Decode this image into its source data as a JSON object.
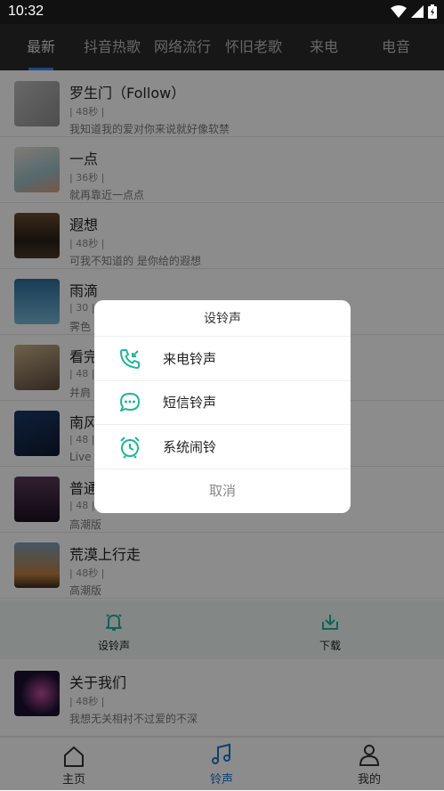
{
  "status": {
    "time": "10:32"
  },
  "tabs": [
    "最新",
    "抖音热歌",
    "网络流行",
    "怀旧老歌",
    "来电",
    "电音"
  ],
  "songs": [
    {
      "title": "罗生门（Follow）",
      "duration": "48秒",
      "desc": "我知道我的爱对你来说就好像软禁"
    },
    {
      "title": "一点",
      "duration": "36秒",
      "desc": "就再靠近一点点"
    },
    {
      "title": "遐想",
      "duration": "48秒",
      "desc": "可我不知道的 是你给的遐想"
    },
    {
      "title": "雨滴",
      "duration": "30",
      "desc": "霁色"
    },
    {
      "title": "看完",
      "duration": "48",
      "desc": "并肩"
    },
    {
      "title": "南风",
      "duration": "48",
      "desc": "Live"
    },
    {
      "title": "普通",
      "duration": "48",
      "desc": "高潮版"
    },
    {
      "title": "荒漠上行走",
      "duration": "48秒",
      "desc": "高潮版"
    },
    {
      "title": "关于我们",
      "duration": "48秒",
      "desc": "我想无关相衬不过爱的不深"
    }
  ],
  "actions": {
    "set_ringtone": "设铃声",
    "download": "下载"
  },
  "nav": {
    "home": "主页",
    "ringtone": "铃声",
    "mine": "我的"
  },
  "dialog": {
    "title": "设铃声",
    "options": [
      {
        "label": "来电铃声",
        "icon": "phone-incoming-icon"
      },
      {
        "label": "短信铃声",
        "icon": "message-icon"
      },
      {
        "label": "系统闹铃",
        "icon": "alarm-clock-icon"
      }
    ],
    "cancel": "取消"
  },
  "colors": {
    "accent": "#1fb59a",
    "nav_active": "#1677cc",
    "tab_indicator": "#3b82f6"
  }
}
